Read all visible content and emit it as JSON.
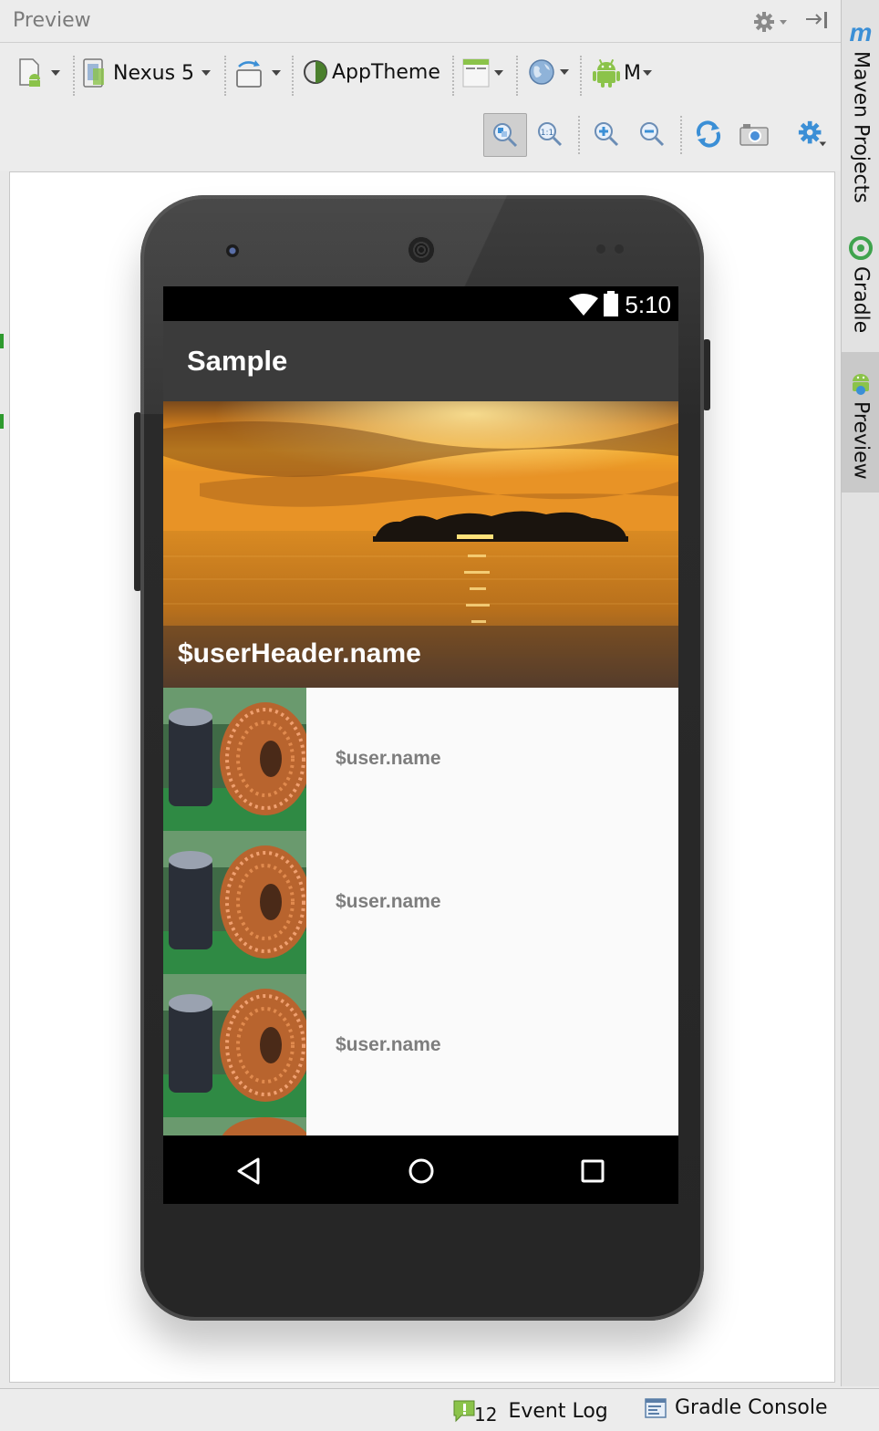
{
  "panel": {
    "title": "Preview"
  },
  "toolbar": {
    "device": "Nexus 5",
    "theme": "AppTheme",
    "api_level": "M"
  },
  "phone": {
    "status_time": "5:10",
    "app_title": "Sample",
    "header_caption": "$userHeader.name",
    "rows": [
      {
        "label": "$user.name"
      },
      {
        "label": "$user.name"
      },
      {
        "label": "$user.name"
      }
    ]
  },
  "right_strip": {
    "maven_letter": "m",
    "tabs": [
      {
        "label": "Maven Projects"
      },
      {
        "label": "Gradle"
      },
      {
        "label": "Preview"
      }
    ]
  },
  "bottom_bar": {
    "event_count": "12",
    "event_log": "Event Log",
    "gradle_console": "Gradle Console"
  },
  "colors": {
    "android_green": "#8bc34a",
    "accent_blue": "#3b8fd6",
    "appbar": "#3b3b3b"
  }
}
